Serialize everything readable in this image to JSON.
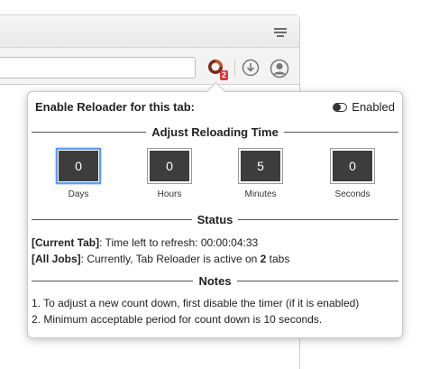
{
  "popup": {
    "title": "Enable Reloader for this tab:",
    "toggle_label": "Enabled",
    "adjust_title": "Adjust Reloading Time",
    "time_fields": [
      {
        "value": "0",
        "label": "Days"
      },
      {
        "value": "0",
        "label": "Hours"
      },
      {
        "value": "5",
        "label": "Minutes"
      },
      {
        "value": "0",
        "label": "Seconds"
      }
    ],
    "status_title": "Status",
    "current_tab_label": "[Current Tab]",
    "current_tab_text": ": Time left to refresh: 00:00:04:33",
    "all_jobs_label": "[All Jobs]",
    "all_jobs_text_before": ": Currently, Tab Reloader is active on ",
    "all_jobs_count": "2",
    "all_jobs_text_after": " tabs",
    "notes_title": "Notes",
    "notes": [
      "1. To adjust a new count down, first disable the timer (if it is enabled)",
      "2. Minimum acceptable period for count down is 10 seconds."
    ]
  },
  "toolbar": {
    "extension_badge": "2"
  },
  "icons": {
    "menu": "hamburger-menu-icon",
    "extension": "tab-reloader-icon",
    "download": "download-icon",
    "account": "account-icon"
  },
  "colors": {
    "focus_ring": "#5d9cec",
    "time_box_bg": "#3d3d3d",
    "badge": "#d83a3a"
  }
}
